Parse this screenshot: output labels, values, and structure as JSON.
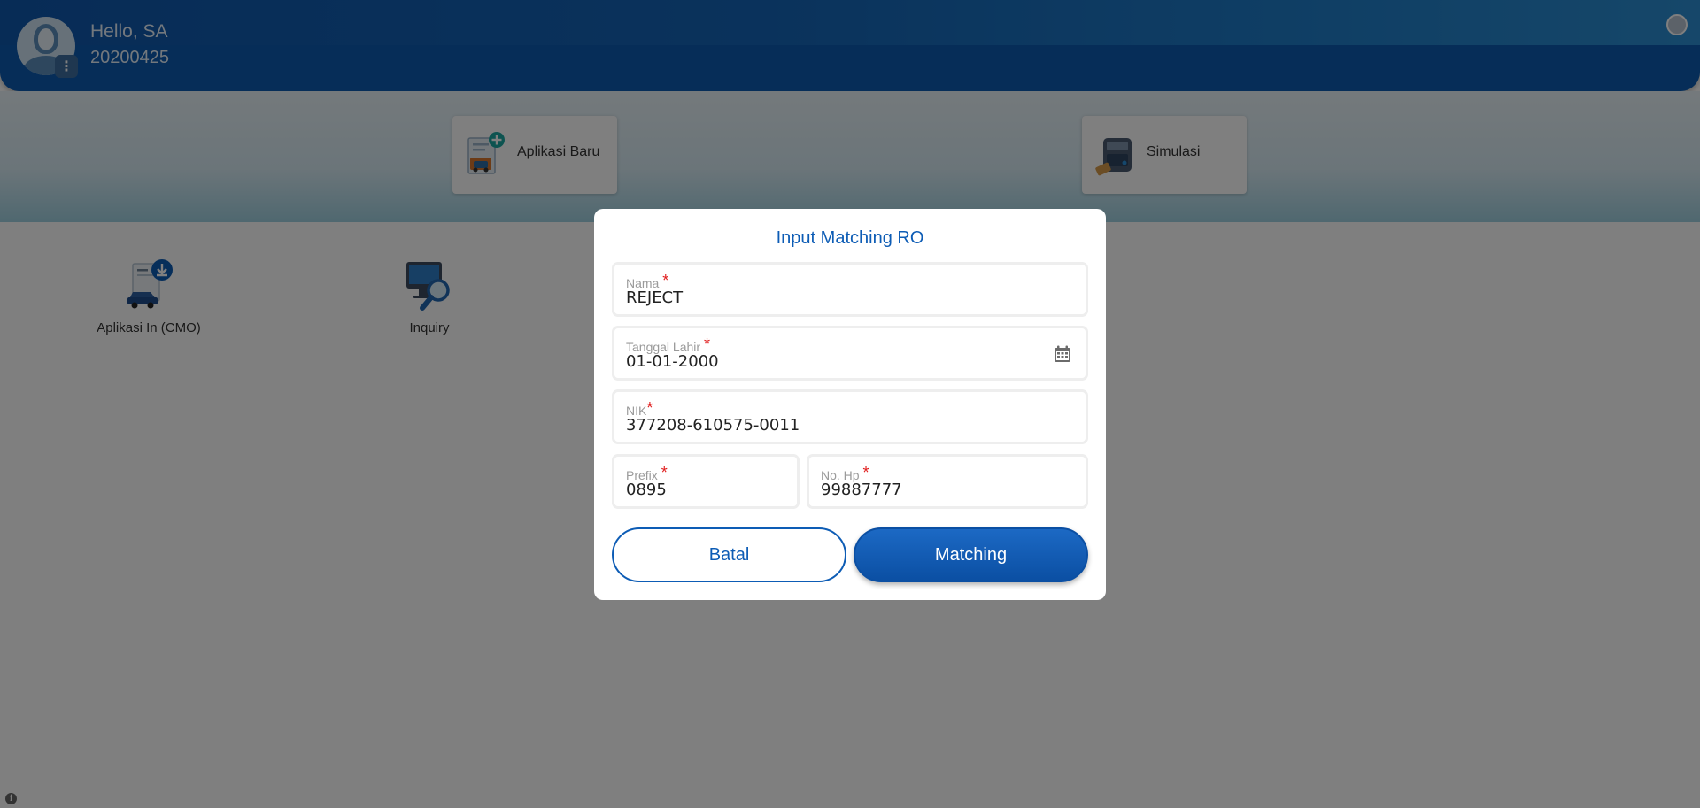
{
  "header": {
    "greeting": "Hello, SA",
    "user_id": "20200425",
    "avatar_menu_icon": "vertical-dots-icon"
  },
  "quick_cards": [
    {
      "label": "Aplikasi Baru",
      "icon": "new-application-icon"
    },
    {
      "label": "Simulasi",
      "icon": "calculator-wallet-icon"
    }
  ],
  "menu": [
    {
      "label": "Aplikasi In (CMO)",
      "icon": "download-car-icon"
    },
    {
      "label": "Inquiry",
      "icon": "monitor-search-icon"
    }
  ],
  "modal": {
    "title": "Input Matching RO",
    "required_mark": "*",
    "fields": {
      "nama": {
        "label": "Nama",
        "value": "REJECT"
      },
      "tanggal_lahir": {
        "label": "Tanggal Lahir",
        "value": "01-01-2000",
        "icon": "calendar-icon"
      },
      "nik": {
        "label": "NIK",
        "value": "377208-610575-0011"
      },
      "prefix": {
        "label": "Prefix",
        "value": "0895"
      },
      "no_hp": {
        "label": "No. Hp",
        "value": "99887777"
      }
    },
    "buttons": {
      "cancel": "Batal",
      "submit": "Matching"
    }
  },
  "colors": {
    "primary": "#0d5cb5",
    "required": "#e01b1b",
    "overlay": "rgba(0,0,0,0.5)"
  }
}
